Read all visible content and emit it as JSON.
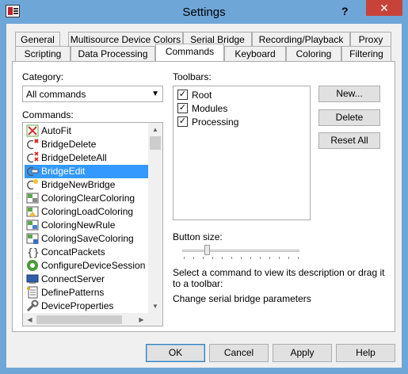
{
  "window": {
    "title": "Settings",
    "help": "?",
    "close": "✕"
  },
  "tabs": {
    "row1": [
      {
        "label": "General"
      },
      {
        "label": "Multisource Device Colors"
      },
      {
        "label": "Serial Bridge"
      },
      {
        "label": "Recording/Playback"
      },
      {
        "label": "Proxy"
      }
    ],
    "row2": [
      {
        "label": "Scripting"
      },
      {
        "label": "Data Processing"
      },
      {
        "label": "Commands",
        "active": true
      },
      {
        "label": "Keyboard"
      },
      {
        "label": "Coloring"
      },
      {
        "label": "Filtering"
      }
    ]
  },
  "category": {
    "label": "Category:",
    "value": "All commands"
  },
  "commands": {
    "label": "Commands:",
    "selected": "BridgeEdit",
    "items": [
      {
        "label": "AutoFit",
        "icon": "autofit-icon"
      },
      {
        "label": "BridgeDelete",
        "icon": "bridge-delete-icon"
      },
      {
        "label": "BridgeDeleteAll",
        "icon": "bridge-delete-all-icon"
      },
      {
        "label": "BridgeEdit",
        "icon": "bridge-edit-icon"
      },
      {
        "label": "BridgeNewBridge",
        "icon": "bridge-new-icon"
      },
      {
        "label": "ColoringClearColoring",
        "icon": "coloring-clear-icon"
      },
      {
        "label": "ColoringLoadColoring",
        "icon": "coloring-load-icon"
      },
      {
        "label": "ColoringNewRule",
        "icon": "coloring-new-rule-icon"
      },
      {
        "label": "ColoringSaveColoring",
        "icon": "coloring-save-icon"
      },
      {
        "label": "ConcatPackets",
        "icon": "concat-packets-icon"
      },
      {
        "label": "ConfigureDeviceSession",
        "icon": "configure-session-icon"
      },
      {
        "label": "ConnectServer",
        "icon": "connect-server-icon"
      },
      {
        "label": "DefinePatterns",
        "icon": "define-patterns-icon"
      },
      {
        "label": "DeviceProperties",
        "icon": "device-properties-icon"
      }
    ]
  },
  "toolbars": {
    "label": "Toolbars:",
    "items": [
      {
        "label": "Root",
        "checked": true
      },
      {
        "label": "Modules",
        "checked": true
      },
      {
        "label": "Processing",
        "checked": true
      }
    ],
    "checkmark": "✓"
  },
  "toolbar_buttons": {
    "new": "New...",
    "delete": "Delete",
    "reset": "Reset All"
  },
  "button_size": {
    "label": "Button size:",
    "level": 0.2
  },
  "description": {
    "hint": "Select a command to view its description or drag it to a toolbar:",
    "text": "Change serial bridge parameters"
  },
  "dialog_buttons": {
    "ok": "OK",
    "cancel": "Cancel",
    "apply": "Apply",
    "help": "Help"
  },
  "scroll_glyphs": {
    "up": "▲",
    "down": "▼",
    "left": "◀",
    "right": "▶",
    "dropdown": "▼"
  }
}
